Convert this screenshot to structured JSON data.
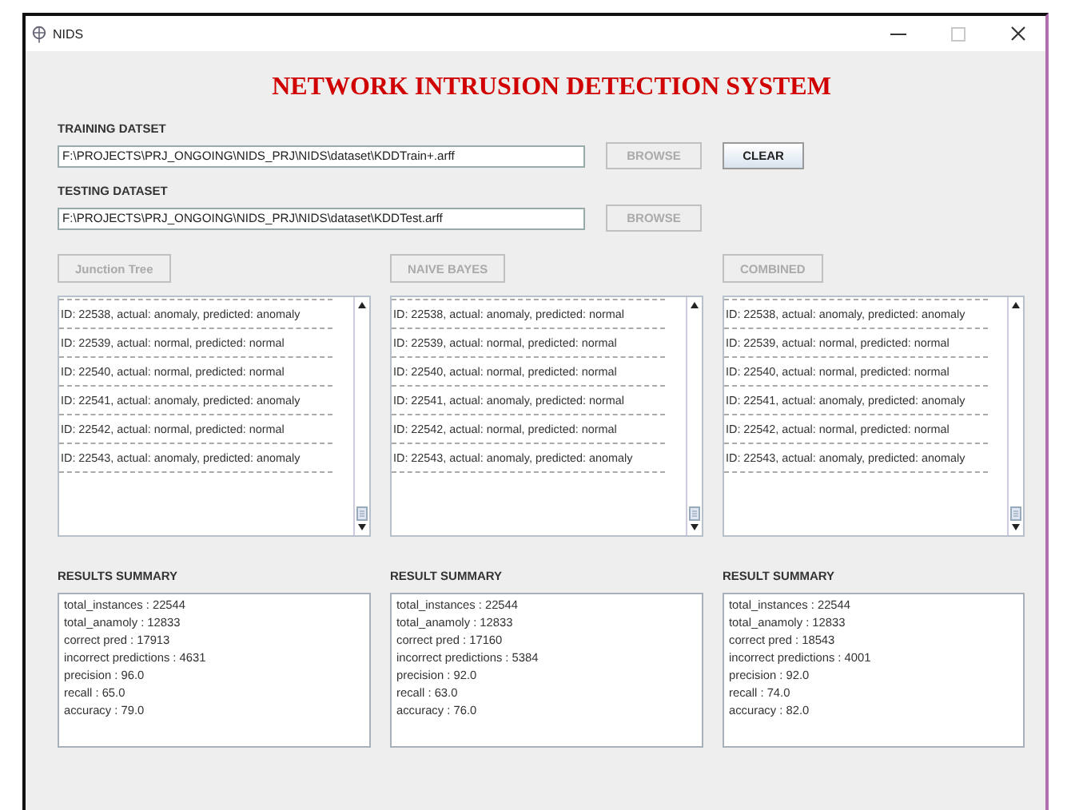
{
  "window": {
    "title": "NIDS"
  },
  "heading": "NETWORK INTRUSION DETECTION SYSTEM",
  "datasets": [
    {
      "label": "TRAINING DATSET",
      "value": "F:\\PROJECTS\\PRJ_ONGOING\\NIDS_PRJ\\NIDS\\dataset\\KDDTrain+.arff",
      "browse": {
        "label": "BROWSE",
        "disabled": true
      },
      "clear": {
        "label": "CLEAR",
        "disabled": false
      }
    },
    {
      "label": "TESTING DATASET",
      "value": "F:\\PROJECTS\\PRJ_ONGOING\\NIDS_PRJ\\NIDS\\dataset\\KDDTest.arff",
      "browse": {
        "label": "BROWSE",
        "disabled": true
      }
    }
  ],
  "panels": [
    {
      "button": {
        "label": "Junction Tree",
        "disabled": true
      },
      "predictions": [
        "ID: 22538, actual: anomaly, predicted: anomaly",
        "ID: 22539, actual: normal, predicted: normal",
        "ID: 22540, actual: normal, predicted: normal",
        "ID: 22541, actual: anomaly, predicted: anomaly",
        "ID: 22542, actual: normal, predicted: normal",
        "ID: 22543, actual: anomaly, predicted: anomaly"
      ],
      "summary_title": "RESULTS SUMMARY",
      "summary": [
        "total_instances : 22544",
        "total_anamoly : 12833",
        "correct pred : 17913",
        "incorrect predictions : 4631",
        "precision : 96.0",
        "recall : 65.0",
        "accuracy : 79.0"
      ]
    },
    {
      "button": {
        "label": "NAIVE BAYES",
        "disabled": true
      },
      "predictions": [
        "ID: 22538, actual: anomaly, predicted: normal",
        "ID: 22539, actual: normal, predicted: normal",
        "ID: 22540, actual: normal, predicted: normal",
        "ID: 22541, actual: anomaly, predicted: normal",
        "ID: 22542, actual: normal, predicted: normal",
        "ID: 22543, actual: anomaly, predicted: anomaly"
      ],
      "summary_title": "RESULT SUMMARY",
      "summary": [
        "total_instances : 22544",
        "total_anamoly : 12833",
        "correct pred : 17160",
        "incorrect predictions : 5384",
        "precision : 92.0",
        "recall : 63.0",
        "accuracy : 76.0"
      ]
    },
    {
      "button": {
        "label": "COMBINED",
        "disabled": true
      },
      "predictions": [
        "ID: 22538, actual: anomaly, predicted: anomaly",
        "ID: 22539, actual: normal, predicted: normal",
        "ID: 22540, actual: normal, predicted: normal",
        "ID: 22541, actual: anomaly, predicted: anomaly",
        "ID: 22542, actual: normal, predicted: normal",
        "ID: 22543, actual: anomaly, predicted: anomaly"
      ],
      "summary_title": "RESULT SUMMARY",
      "summary": [
        "total_instances : 22544",
        "total_anamoly : 12833",
        "correct pred : 18543",
        "incorrect predictions : 4001",
        "precision : 92.0",
        "recall : 74.0",
        "accuracy : 82.0"
      ]
    }
  ]
}
